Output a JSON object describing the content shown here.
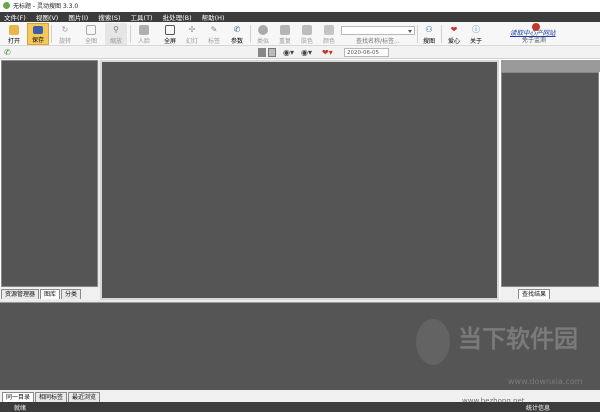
{
  "window": {
    "title": "无标题 - 灵动搜图 3.3.0"
  },
  "menu": [
    "文件(F)",
    "视图(V)",
    "图片(I)",
    "搜索(S)",
    "工具(T)",
    "批处理(B)",
    "帮助(H)"
  ],
  "toolbar": {
    "buttons": [
      {
        "label": "打开",
        "icon": "folder-open-icon",
        "state": "normal"
      },
      {
        "label": "保存",
        "icon": "save-icon",
        "state": "active"
      },
      {
        "label": "旋转",
        "icon": "rotate-icon",
        "state": "disabled"
      },
      {
        "label": "全图",
        "icon": "fit-screen-icon",
        "state": "disabled"
      },
      {
        "label": "缩放",
        "icon": "zoom-icon",
        "state": "disabled"
      },
      {
        "label": "人脸",
        "icon": "face-icon",
        "state": "disabled"
      },
      {
        "label": "全屏",
        "icon": "fullscreen-icon",
        "state": "normal"
      },
      {
        "label": "幻灯",
        "icon": "slideshow-icon",
        "state": "disabled"
      },
      {
        "label": "标签",
        "icon": "tag-icon",
        "state": "disabled"
      },
      {
        "label": "参数",
        "icon": "wrench-icon",
        "state": "normal"
      },
      {
        "label": "类似",
        "icon": "similar-icon",
        "state": "disabled"
      },
      {
        "label": "重复",
        "icon": "duplicate-icon",
        "state": "disabled"
      },
      {
        "label": "肤色",
        "icon": "skin-color-icon",
        "state": "disabled"
      },
      {
        "label": "颜色",
        "icon": "color-icon",
        "state": "disabled"
      },
      {
        "label": "搜图",
        "icon": "search-image-icon",
        "state": "normal"
      },
      {
        "label": "爱心",
        "icon": "heart-icon",
        "state": "normal"
      },
      {
        "label": "关于",
        "icon": "about-icon",
        "state": "normal"
      }
    ],
    "search_hint": "查找名称/标签...",
    "link_text": "读取中心产网站",
    "link_sub": "免于监测"
  },
  "toolbar2": {
    "date": "2020-06-05"
  },
  "left_tabs": [
    {
      "label": "资源管理器",
      "selected": false
    },
    {
      "label": "图库",
      "selected": true
    },
    {
      "label": "分类",
      "selected": false
    }
  ],
  "right_tabs": [
    {
      "label": "查找结果",
      "selected": true
    }
  ],
  "bottom_tabs": [
    {
      "label": "同一目录",
      "selected": true
    },
    {
      "label": "相同标签",
      "selected": false
    },
    {
      "label": "最近浏览",
      "selected": false
    }
  ],
  "status": {
    "left": "就绪",
    "right": "统计信息"
  },
  "watermark": {
    "title": "当下软件园",
    "url": "www.downxia.com",
    "url2": "www.bezhong.net"
  }
}
